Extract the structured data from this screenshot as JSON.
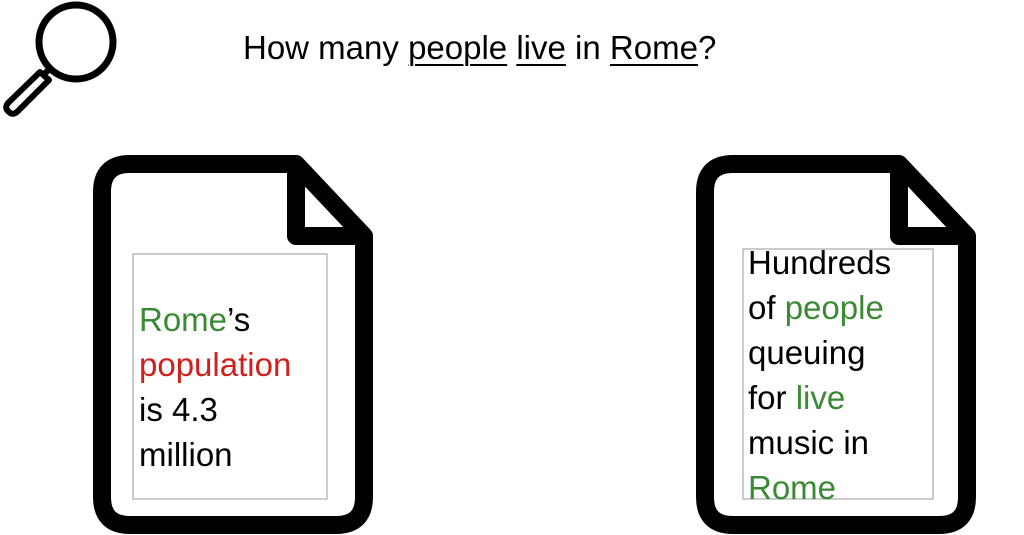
{
  "query": {
    "before": "How many ",
    "kw1": "people",
    "sep1": " ",
    "kw2": "live",
    "mid": " in ",
    "kw3": "Rome",
    "after": "?"
  },
  "doc_left": {
    "l1_a": "Rome",
    "l1_b": "’s",
    "l2": "population",
    "l3": "is 4.3",
    "l4": "million"
  },
  "doc_right": {
    "l1": "Hundreds",
    "l2_a": "of ",
    "l2_b": "people",
    "l3": "queuing",
    "l4_a": "for ",
    "l4_b": "live",
    "l5": "music in",
    "l6": "Rome"
  },
  "colors": {
    "match": "#3a8a34",
    "partial": "#d0201e",
    "text": "#000000",
    "outline": "#000000"
  },
  "icons": [
    "magnifier-icon",
    "document-icon"
  ]
}
